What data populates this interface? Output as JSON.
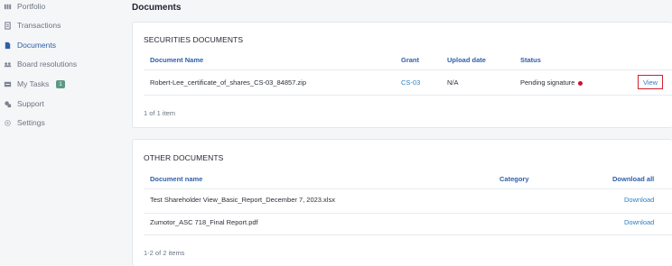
{
  "sidebar": {
    "items": [
      {
        "label": "Portfolio",
        "icon": "portfolio-icon"
      },
      {
        "label": "Transactions",
        "icon": "transactions-icon"
      },
      {
        "label": "Documents",
        "icon": "documents-icon",
        "active": true
      },
      {
        "label": "Board resolutions",
        "icon": "board-resolutions-icon"
      },
      {
        "label": "My Tasks",
        "icon": "tasks-icon",
        "badge": "1"
      },
      {
        "label": "Support",
        "icon": "support-icon"
      },
      {
        "label": "Settings",
        "icon": "settings-icon"
      }
    ]
  },
  "page": {
    "title": "Documents"
  },
  "securities": {
    "title": "SECURITIES DOCUMENTS",
    "columns": {
      "name": "Document Name",
      "grant": "Grant",
      "upload": "Upload date",
      "status": "Status"
    },
    "rows": [
      {
        "name": "Robert-Lee_certificate_of_shares_CS-03_84857.zip",
        "grant": "CS-03",
        "upload": "N/A",
        "status": "Pending signature",
        "action": "View"
      }
    ],
    "footer": "1 of 1 item"
  },
  "other": {
    "title": "OTHER DOCUMENTS",
    "columns": {
      "name": "Document name",
      "category": "Category",
      "download_all": "Download all"
    },
    "rows": [
      {
        "name": "Test Shareholder View_Basic_Report_December 7, 2023.xlsx",
        "category": "",
        "action": "Download"
      },
      {
        "name": "Zumotor_ASC 718_Final Report.pdf",
        "category": "",
        "action": "Download"
      }
    ],
    "footer": "1-2 of 2 items"
  },
  "colors": {
    "accent": "#2f5fa8",
    "link": "#2f7fc1",
    "status_dot": "#d0102a",
    "highlight_border": "#d1202f"
  }
}
